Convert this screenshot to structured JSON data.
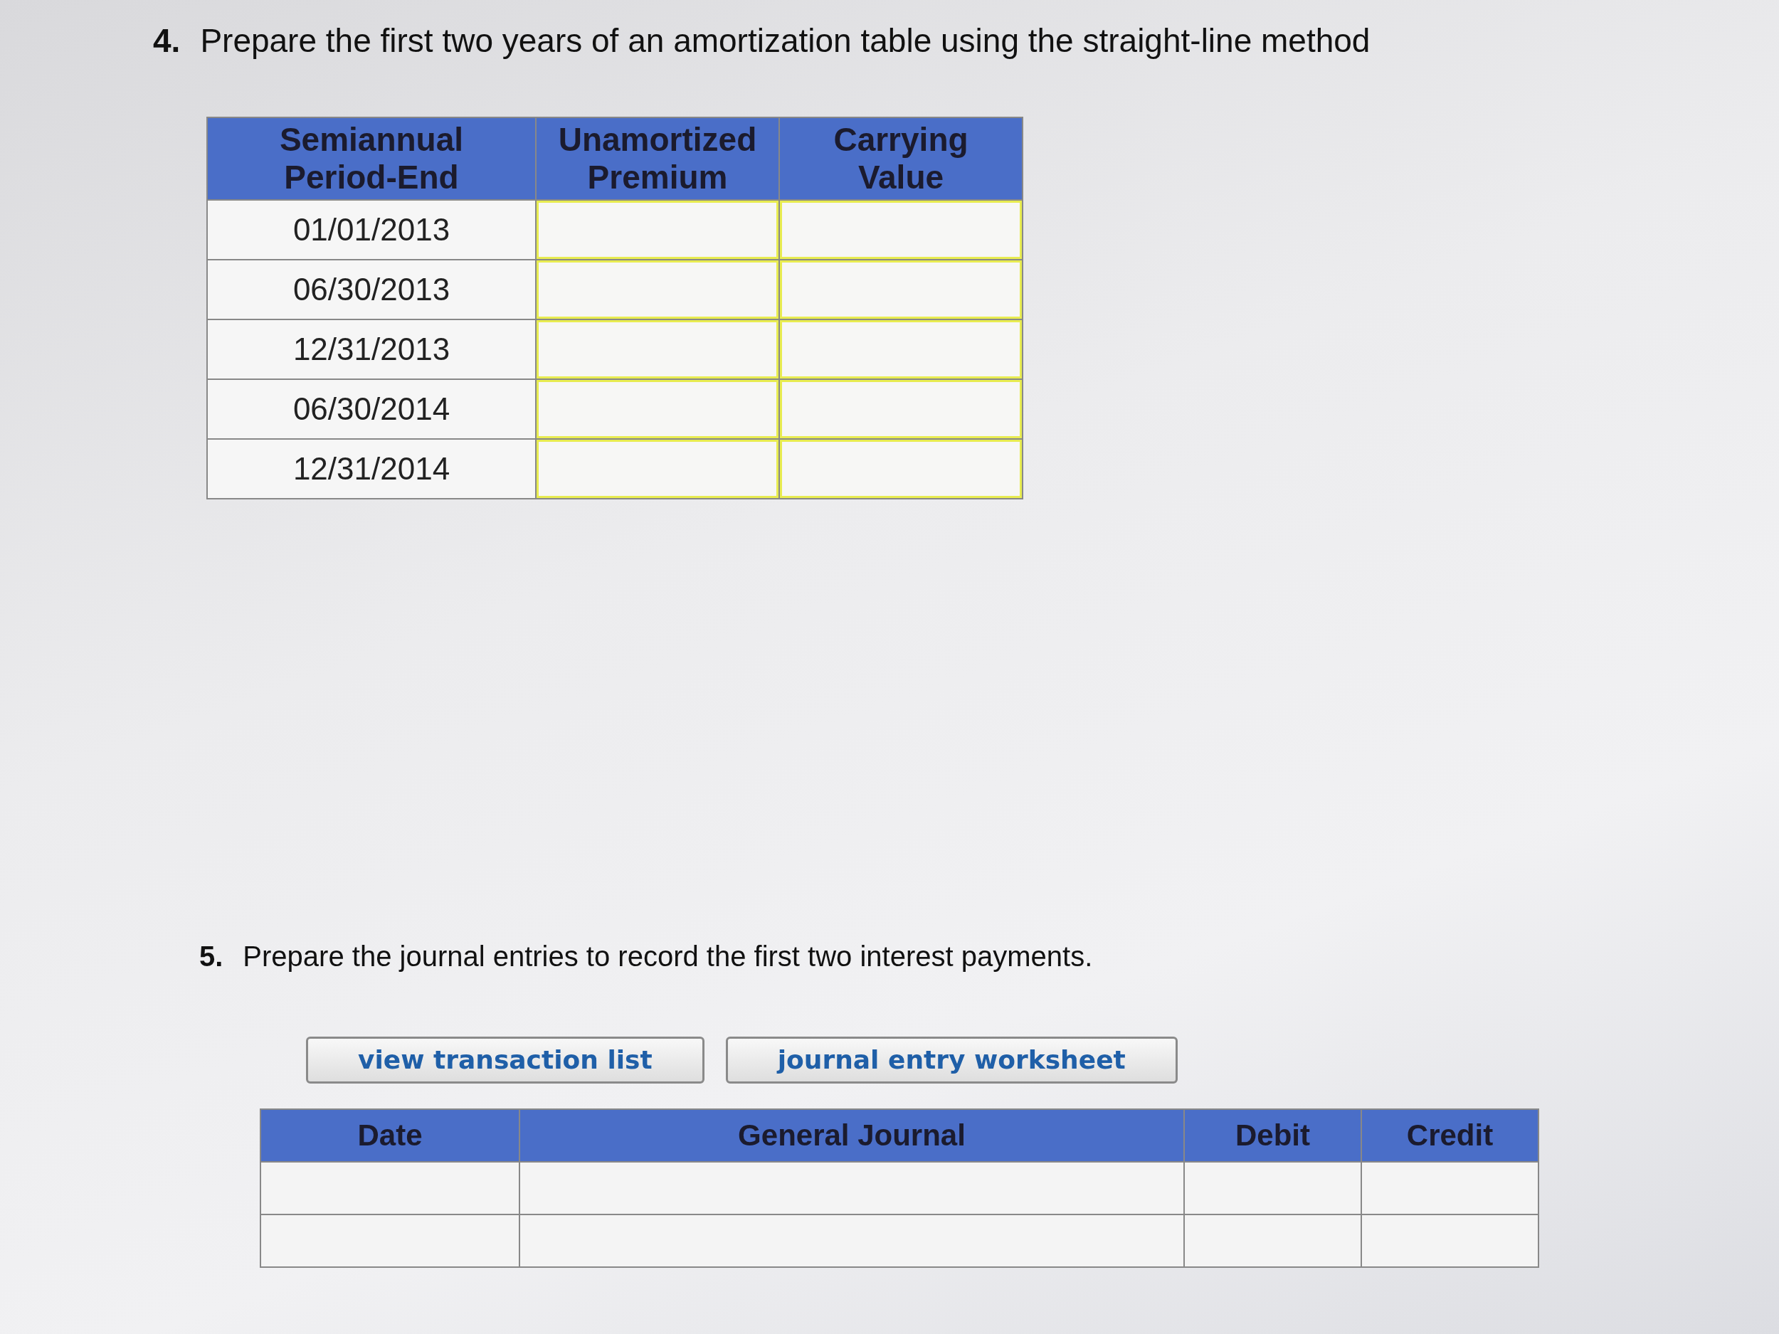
{
  "question_4": {
    "number": "4.",
    "text": "Prepare the first two years of an amortization table using the straight-line method"
  },
  "amortization_table": {
    "columns": [
      "Semiannual Period-End",
      "Unamortized Premium",
      "Carrying Value"
    ],
    "rows": [
      {
        "date": "01/01/2013"
      },
      {
        "date": "06/30/2013"
      },
      {
        "date": "12/31/2013"
      },
      {
        "date": "06/30/2014"
      },
      {
        "date": "12/31/2014"
      }
    ]
  },
  "question_5": {
    "number": "5.",
    "text": "Prepare the journal entries to record the first two interest payments."
  },
  "buttons": [
    "view transaction list",
    "journal entry worksheet"
  ],
  "journal_table": {
    "columns": [
      "Date",
      "General Journal",
      "Debit",
      "Credit"
    ],
    "rows": [
      {
        "kind": "entry"
      },
      {
        "kind": "entry"
      }
    ]
  }
}
